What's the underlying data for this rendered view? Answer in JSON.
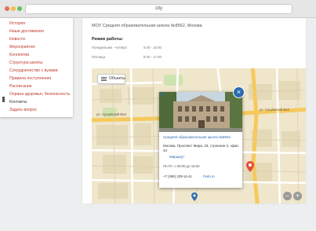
{
  "browser": {
    "url": "city",
    "dots": [
      "#ec6a5e",
      "#f4bf4f",
      "#61c554"
    ]
  },
  "menu": {
    "items": [
      {
        "label": "История",
        "active": false
      },
      {
        "label": "Наши достижения",
        "active": false
      },
      {
        "label": "Новости",
        "active": false
      },
      {
        "label": "Мероприятия",
        "active": false
      },
      {
        "label": "Коллектив",
        "active": false
      },
      {
        "label": "Структура школы",
        "active": false
      },
      {
        "label": "Сотрудничество с вузами",
        "active": false
      },
      {
        "label": "Правила поступления",
        "active": false
      },
      {
        "label": "Расписание",
        "active": false
      },
      {
        "label": "Охрана здоровья, безопасность",
        "active": false
      },
      {
        "label": "Контакты",
        "active": true
      },
      {
        "label": "Задать вопрос",
        "active": false
      }
    ]
  },
  "content": {
    "address": "МОУ Средняя образовательная школа №8562, Москва",
    "hours_title": "Режим работы:",
    "hours": [
      {
        "day": "Понедельник - четверг",
        "time": "8.00 - 18.00"
      },
      {
        "day": "Пятница",
        "time": "8.00 - 17.00"
      }
    ]
  },
  "map": {
    "objects_label": "Объекты",
    "road_labels": [
      "ул. Сущёвский Вал",
      "ул. Сущёвский Вал"
    ],
    "popup": {
      "close": "×",
      "name": "Средняя образовательная школа №8562",
      "address": "Москва, Проспект Мира, 33, строение 2, офис 34",
      "route": "Маршрут",
      "hours": "Пн-Пт: с 08:00 до 18:00",
      "phone": "+7 (495) 229-14-41",
      "link": "Fedo.ru"
    },
    "zoom_in": "+",
    "zoom_out": "−",
    "colors": {
      "accent": "#2b6cb0",
      "menu_link": "#c0392b",
      "pin": "#e74c3c"
    }
  }
}
